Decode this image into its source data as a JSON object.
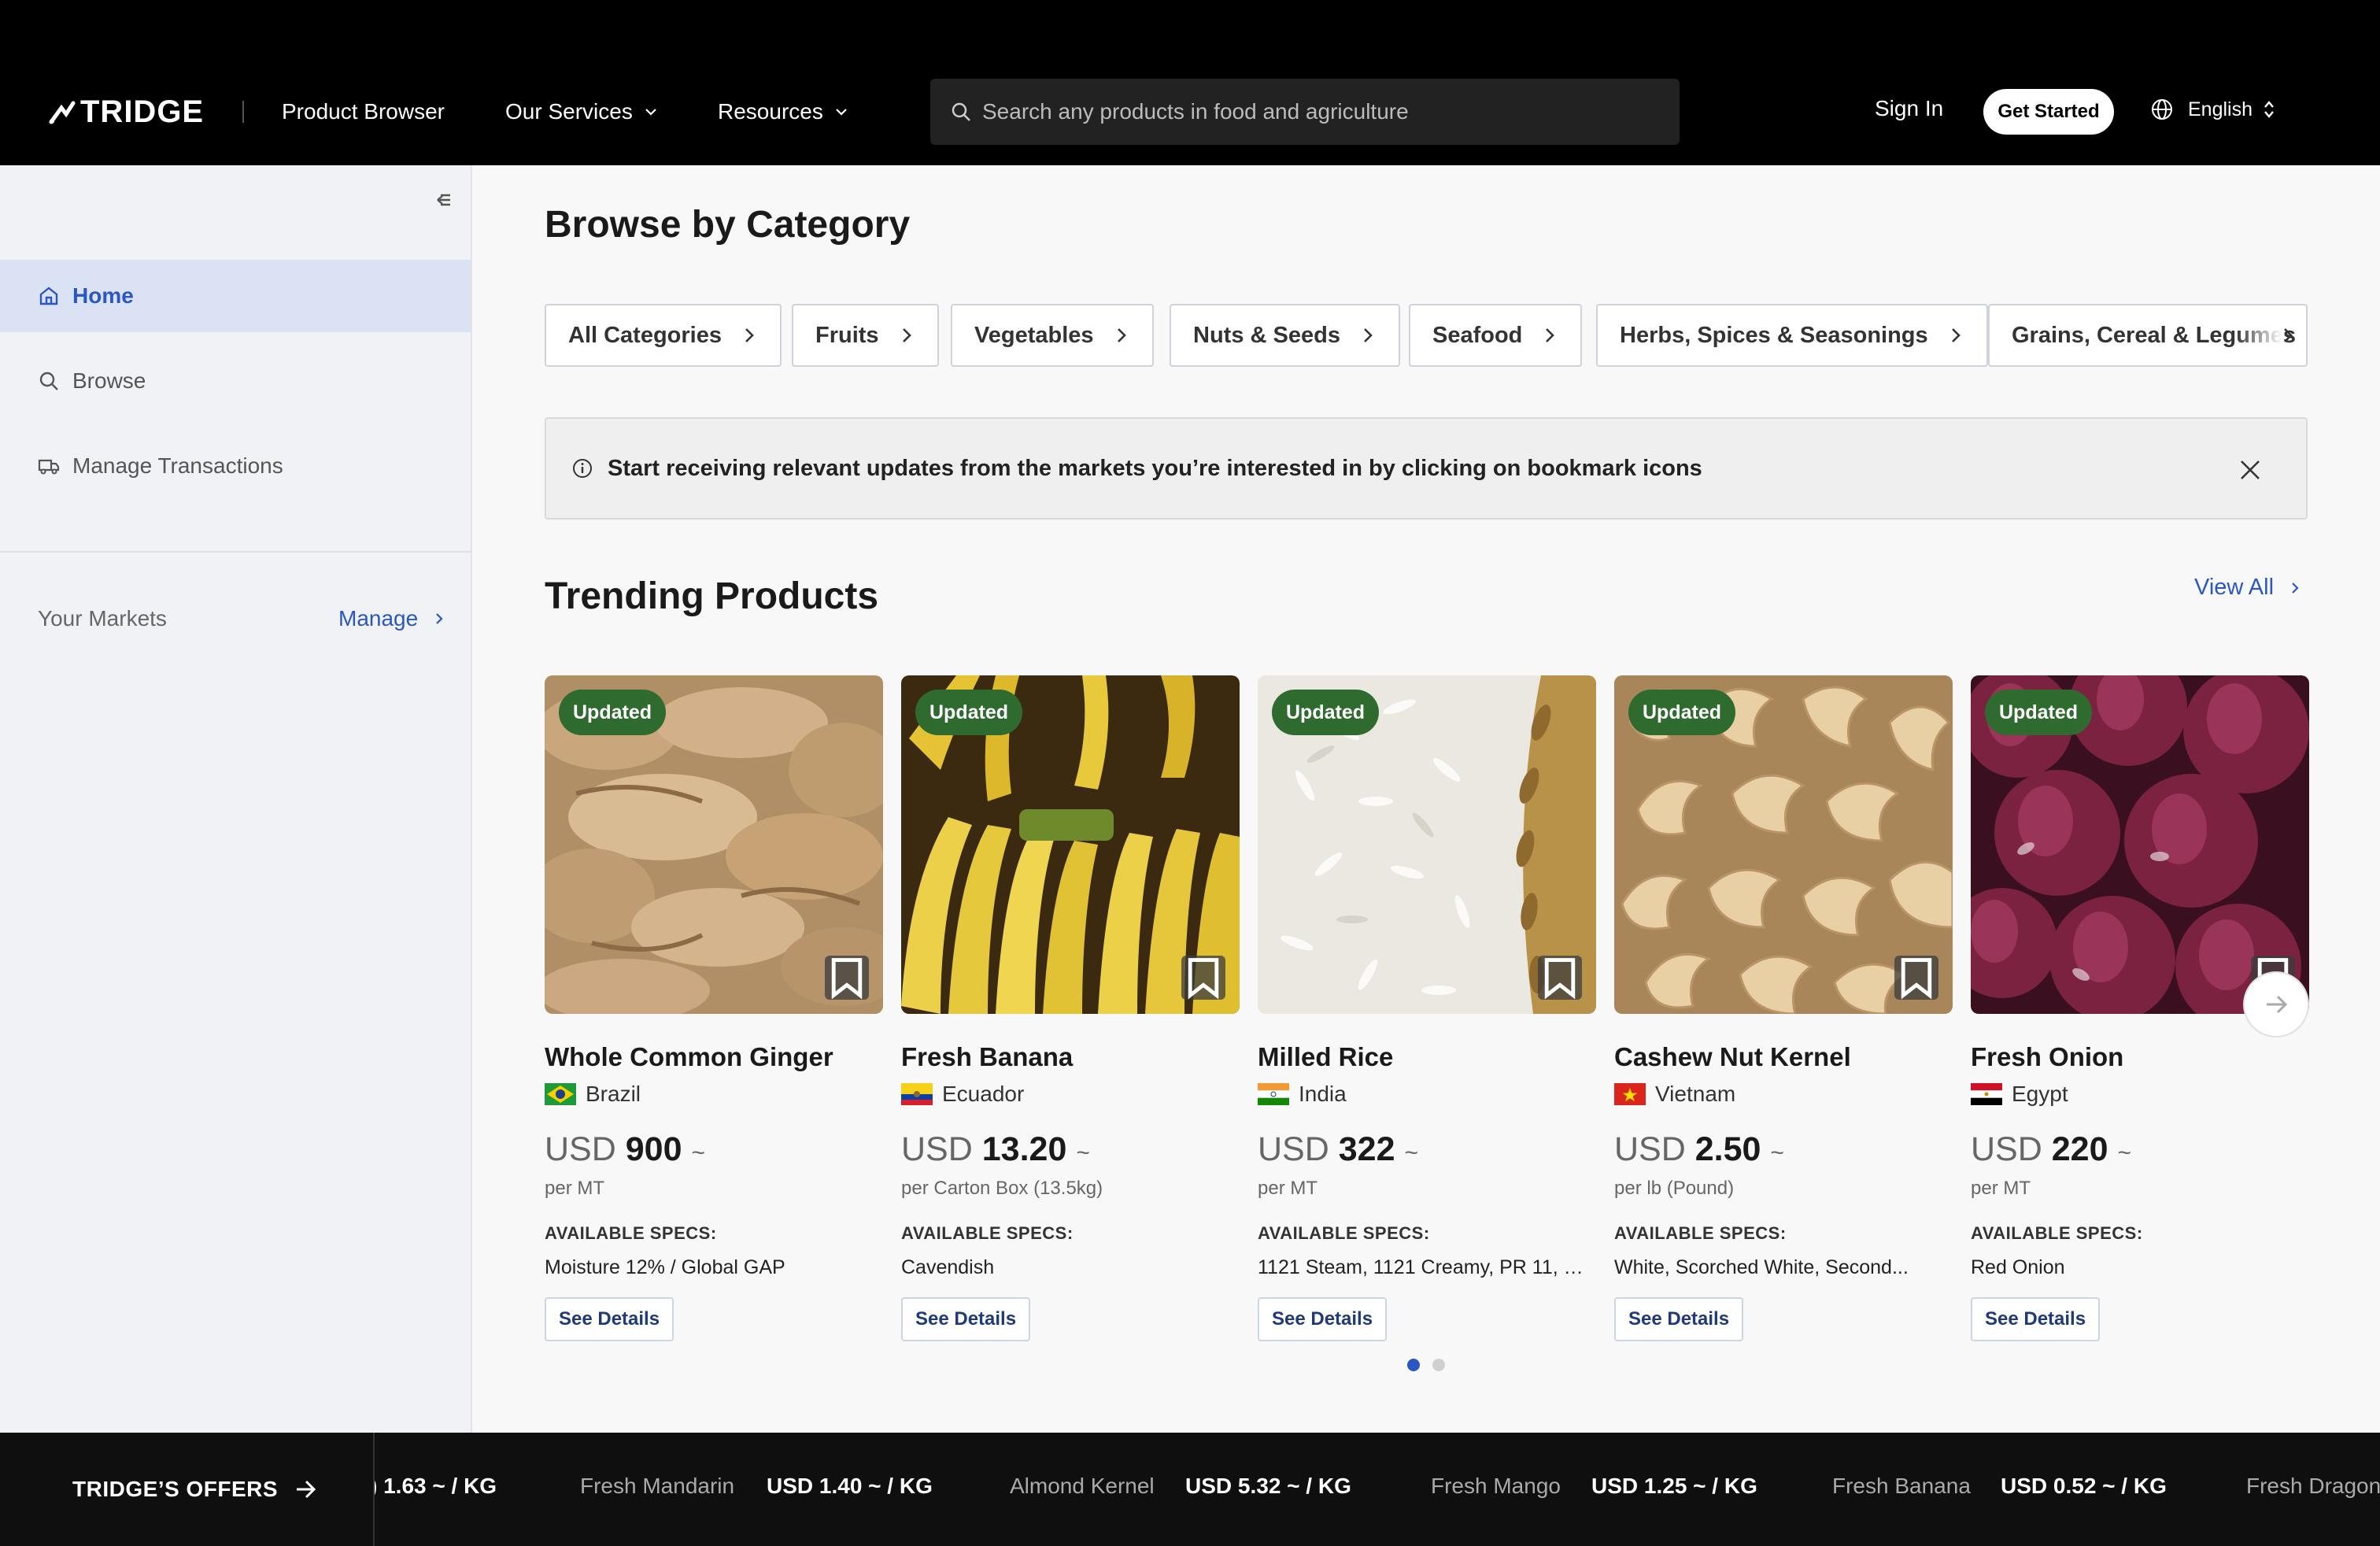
{
  "header": {
    "logo": "TRIDGE",
    "nav": [
      "Product Browser",
      "Our Services",
      "Resources"
    ],
    "search_placeholder": "Search any products in food and agriculture",
    "sign_in": "Sign In",
    "get_started": "Get Started",
    "language": "English"
  },
  "sidebar": {
    "items": [
      {
        "label": "Home",
        "icon": "home-icon",
        "active": true
      },
      {
        "label": "Browse",
        "icon": "search-icon",
        "active": false
      },
      {
        "label": "Manage Transactions",
        "icon": "truck-icon",
        "active": false
      }
    ],
    "your_markets": "Your Markets",
    "manage": "Manage"
  },
  "main": {
    "browse_title": "Browse by Category",
    "categories": [
      "All Categories",
      "Fruits",
      "Vegetables",
      "Nuts & Seeds",
      "Seafood",
      "Herbs, Spices & Seasonings",
      "Grains, Cereal & Legumes"
    ],
    "banner": "Start receiving relevant updates from the markets you’re interested in by clicking on bookmark icons",
    "trending_title": "Trending Products",
    "view_all": "View All",
    "products": [
      {
        "badge": "Updated",
        "name": "Whole Common Ginger",
        "country": "Brazil",
        "currency": "USD",
        "price": "900",
        "tilde": "~",
        "unit": "per MT",
        "spec_label": "AVAILABLE SPECS:",
        "specs": "Moisture 12% / Global GAP",
        "button": "See Details"
      },
      {
        "badge": "Updated",
        "name": "Fresh Banana",
        "country": "Ecuador",
        "currency": "USD",
        "price": "13.20",
        "tilde": "~",
        "unit": "per Carton Box (13.5kg)",
        "spec_label": "AVAILABLE SPECS:",
        "specs": "Cavendish",
        "button": "See Details"
      },
      {
        "badge": "Updated",
        "name": "Milled Rice",
        "country": "India",
        "currency": "USD",
        "price": "322",
        "tilde": "~",
        "unit": "per MT",
        "spec_label": "AVAILABLE SPECS:",
        "specs": "1121 Steam, 1121 Creamy, PR 11, PR...",
        "button": "See Details"
      },
      {
        "badge": "Updated",
        "name": "Cashew Nut Kernel",
        "country": "Vietnam",
        "currency": "USD",
        "price": "2.50",
        "tilde": "~",
        "unit": "per lb (Pound)",
        "spec_label": "AVAILABLE SPECS:",
        "specs": "White, Scorched White, Second...",
        "button": "See Details"
      },
      {
        "badge": "Updated",
        "name": "Fresh Onion",
        "country": "Egypt",
        "currency": "USD",
        "price": "220",
        "tilde": "~",
        "unit": "per MT",
        "spec_label": "AVAILABLE SPECS:",
        "specs": "Red Onion",
        "button": "See Details"
      }
    ],
    "pagination": {
      "current": 1,
      "total": 2
    }
  },
  "ticker": {
    "offers_label": "TRIDGE’S OFFERS",
    "items": [
      {
        "name": "",
        "price": ") 1.63 ~ / KG"
      },
      {
        "name": "Fresh Mandarin",
        "price": "USD 1.40 ~ / KG"
      },
      {
        "name": "Almond Kernel",
        "price": "USD 5.32 ~ / KG"
      },
      {
        "name": "Fresh Mango",
        "price": "USD 1.25 ~ / KG"
      },
      {
        "name": "Fresh Banana",
        "price": "USD 0.52 ~ / KG"
      },
      {
        "name": "Fresh Dragon",
        "price": ""
      }
    ]
  },
  "colors": {
    "accent": "#2b57c4",
    "badge_green": "#2f6b2f"
  }
}
